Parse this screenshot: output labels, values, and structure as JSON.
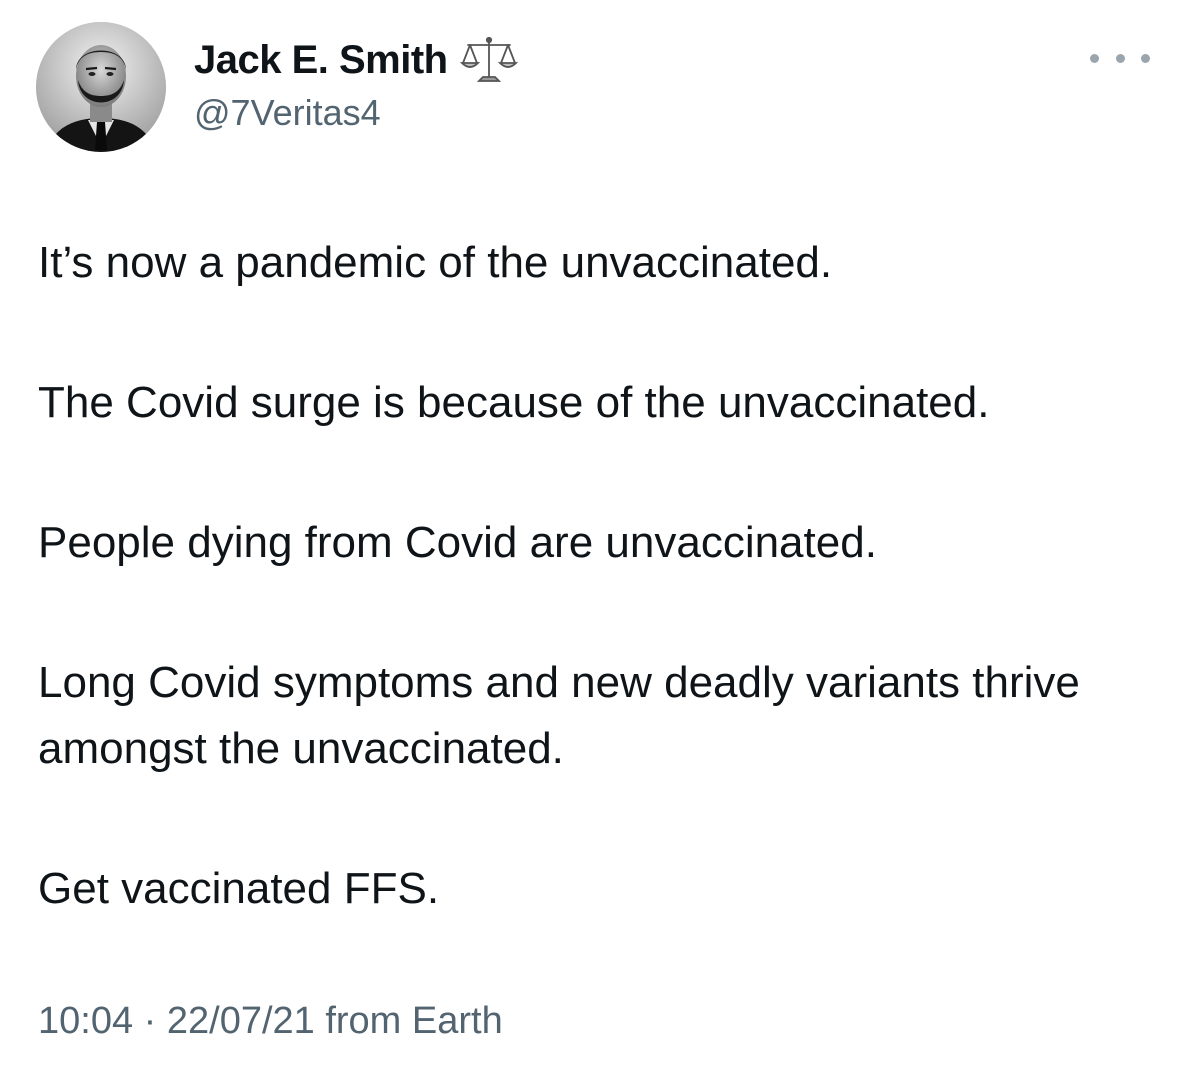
{
  "author": {
    "display_name": "Jack E. Smith",
    "handle": "@7Veritas4",
    "badge_icon": "scales-icon",
    "avatar_icon": "avatar-photo"
  },
  "more_icon": "more-dots-icon",
  "tweet": {
    "paragraphs": [
      "It’s now a pandemic of the unvaccinated.",
      "The Covid surge is because of the unvaccinated.",
      "People dying from Covid are unvaccinated.",
      "Long Covid symptoms and new deadly variants thrive amongst the unvaccinated.",
      "Get vaccinated FFS."
    ],
    "timestamp": "10:04 · 22/07/21 from Earth"
  },
  "colors": {
    "text": "#0f1419",
    "secondary": "#536471",
    "background": "#ffffff"
  }
}
